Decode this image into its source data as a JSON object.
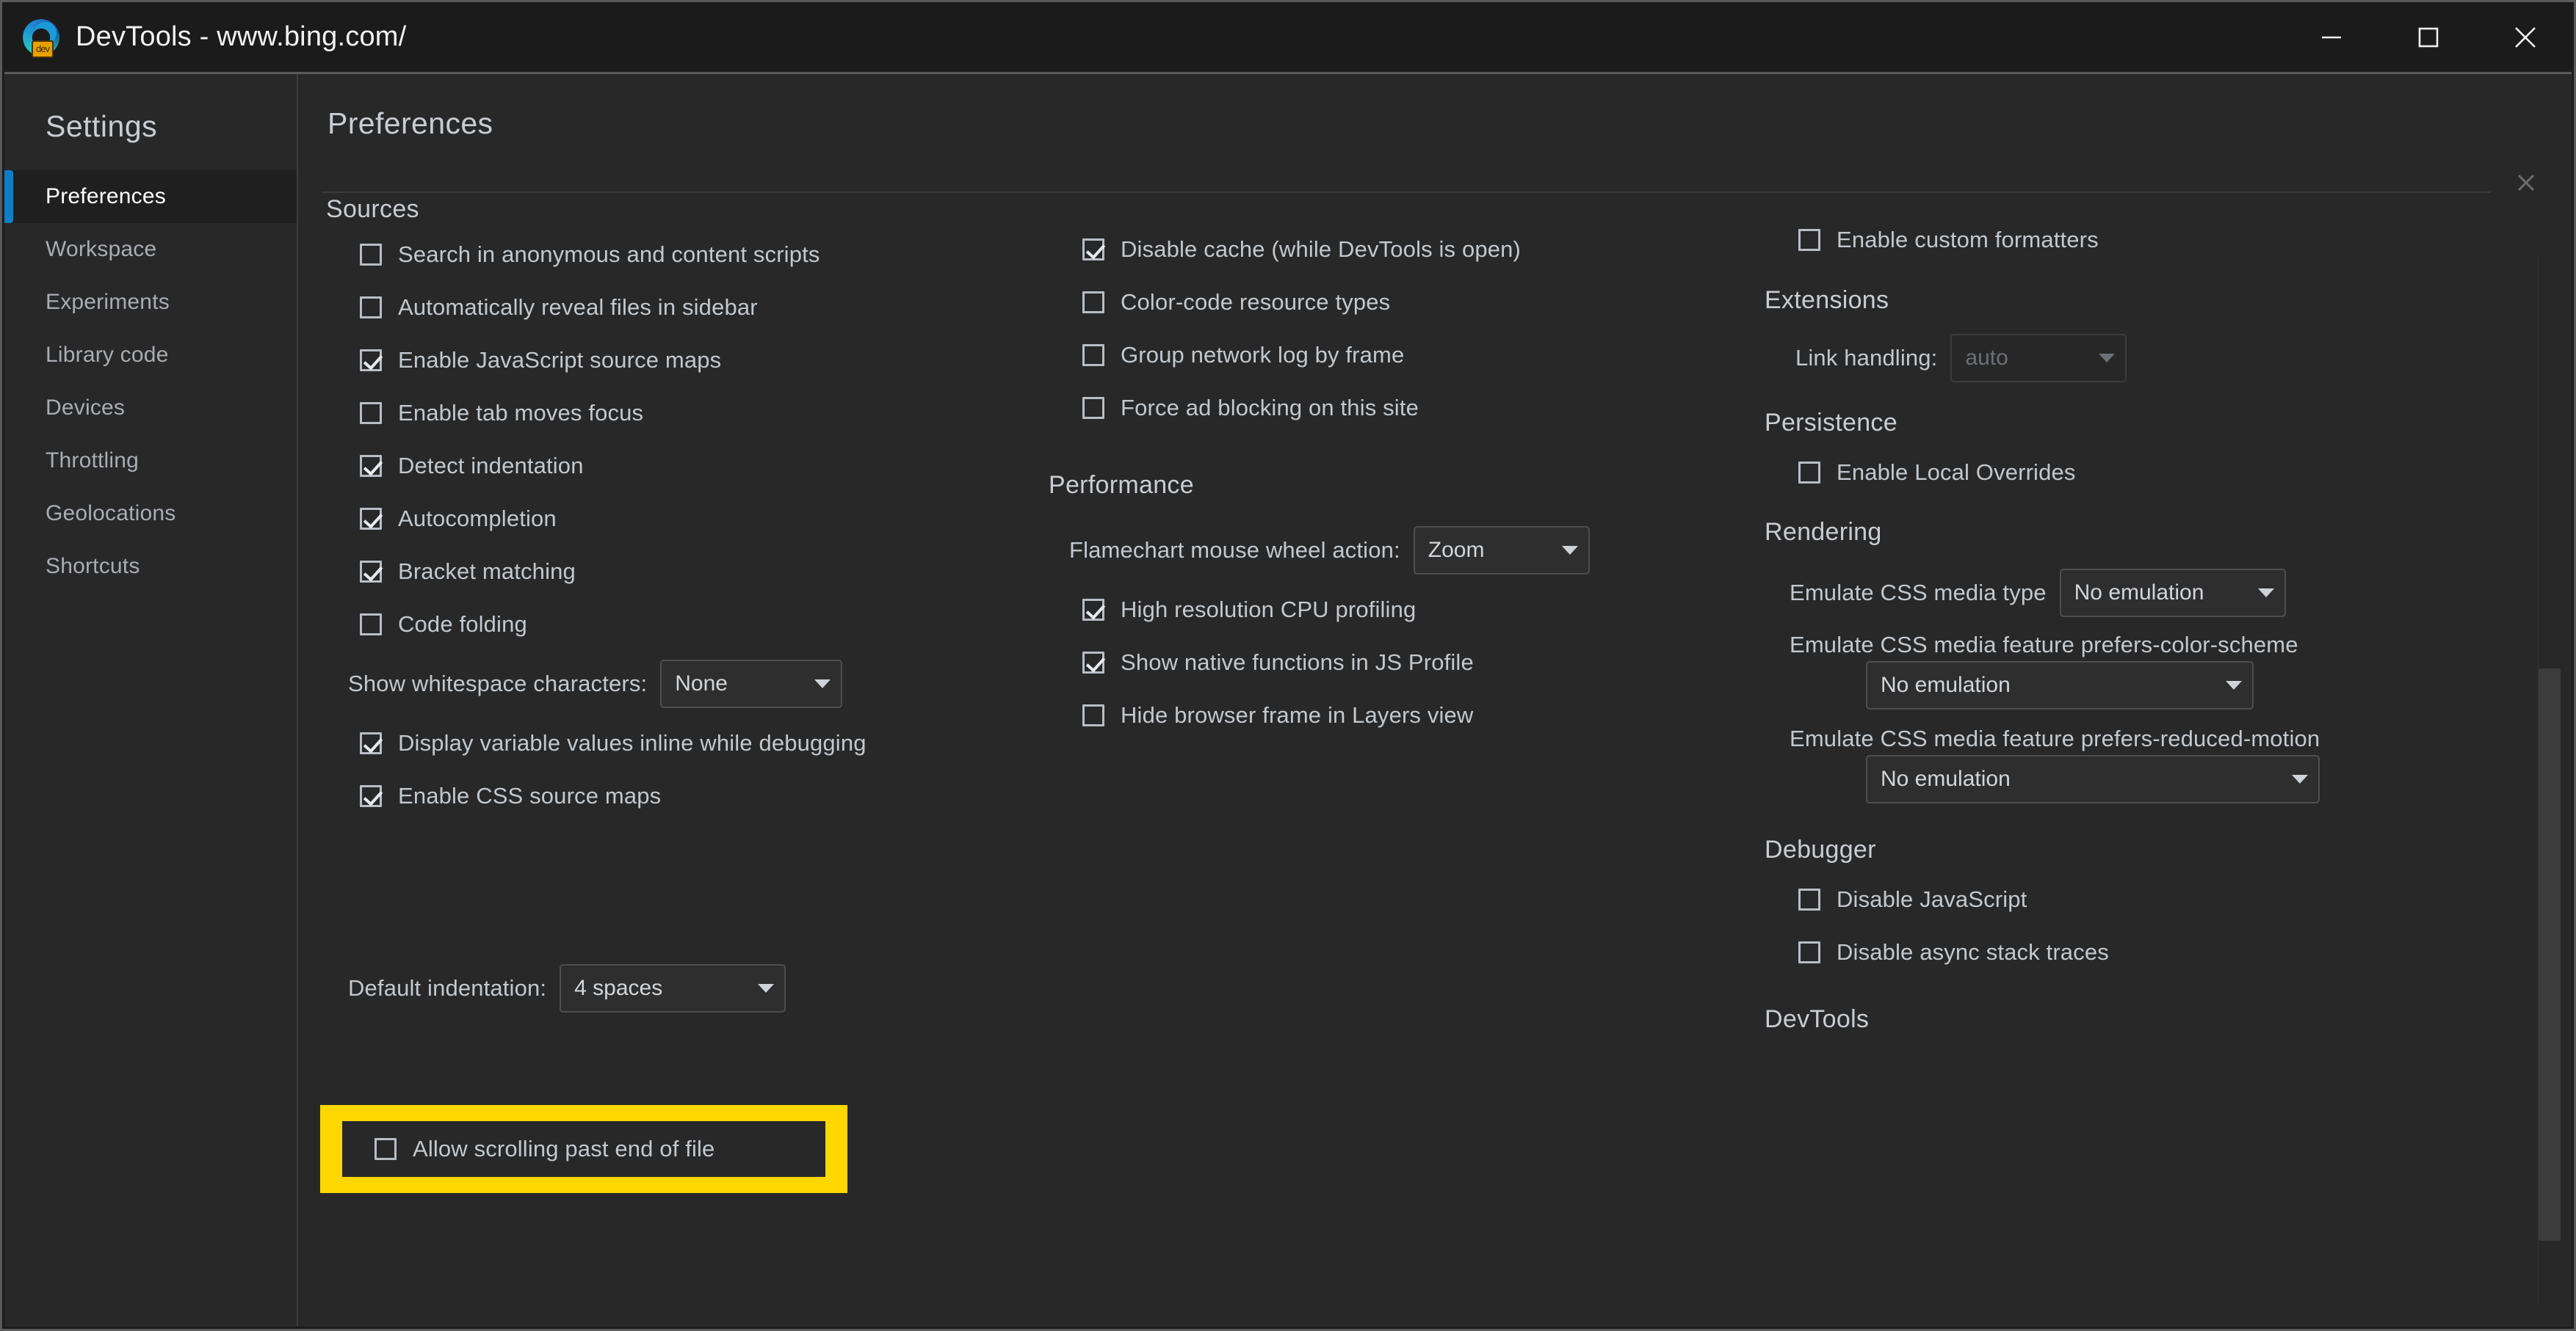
{
  "window": {
    "title": "DevTools - www.bing.com/",
    "app_icon": "edge-devtools-icon",
    "badge_text": "dev",
    "controls": {
      "minimize": "minimize-icon",
      "maximize": "maximize-icon",
      "close": "close-icon"
    }
  },
  "sidebar": {
    "title": "Settings",
    "items": [
      {
        "label": "Preferences",
        "selected": true
      },
      {
        "label": "Workspace",
        "selected": false
      },
      {
        "label": "Experiments",
        "selected": false
      },
      {
        "label": "Library code",
        "selected": false
      },
      {
        "label": "Devices",
        "selected": false
      },
      {
        "label": "Throttling",
        "selected": false
      },
      {
        "label": "Geolocations",
        "selected": false
      },
      {
        "label": "Shortcuts",
        "selected": false
      }
    ]
  },
  "panel": {
    "header": "Preferences",
    "close_label": "×"
  },
  "columns": {
    "left": {
      "section": "Sources",
      "checkboxes": [
        {
          "label": "Search in anonymous and content scripts",
          "checked": false
        },
        {
          "label": "Automatically reveal files in sidebar",
          "checked": false
        },
        {
          "label": "Enable JavaScript source maps",
          "checked": true
        },
        {
          "label": "Enable tab moves focus",
          "checked": false
        },
        {
          "label": "Detect indentation",
          "checked": true
        },
        {
          "label": "Autocompletion",
          "checked": true
        },
        {
          "label": "Bracket matching",
          "checked": true
        },
        {
          "label": "Code folding",
          "checked": false
        }
      ],
      "whitespace": {
        "label": "Show whitespace characters:",
        "value": "None"
      },
      "checkboxes2": [
        {
          "label": "Display variable values inline while debugging",
          "checked": true
        },
        {
          "label": "Enable CSS source maps",
          "checked": true
        }
      ],
      "highlighted": {
        "label": "Allow scrolling past end of file",
        "checked": false
      },
      "indentation": {
        "label": "Default indentation:",
        "value": "4 spaces"
      }
    },
    "middle": {
      "network_checkboxes": [
        {
          "label": "Disable cache (while DevTools is open)",
          "checked": true
        },
        {
          "label": "Color-code resource types",
          "checked": false
        },
        {
          "label": "Group network log by frame",
          "checked": false
        },
        {
          "label": "Force ad blocking on this site",
          "checked": false
        }
      ],
      "performance_section": "Performance",
      "flamechart": {
        "label": "Flamechart mouse wheel action:",
        "value": "Zoom"
      },
      "performance_checkboxes": [
        {
          "label": "High resolution CPU profiling",
          "checked": true
        },
        {
          "label": "Show native functions in JS Profile",
          "checked": true
        },
        {
          "label": "Hide browser frame in Layers view",
          "checked": false
        }
      ]
    },
    "right": {
      "top_checkbox": {
        "label": "Enable custom formatters",
        "checked": false
      },
      "extensions_section": "Extensions",
      "link_handling": {
        "label": "Link handling:",
        "value": "auto",
        "disabled": true
      },
      "persistence_section": "Persistence",
      "persistence_checkbox": {
        "label": "Enable Local Overrides",
        "checked": false
      },
      "rendering_section": "Rendering",
      "media_type": {
        "label": "Emulate CSS media type",
        "value": "No emulation"
      },
      "color_scheme": {
        "label": "Emulate CSS media feature prefers-color-scheme",
        "value": "No emulation"
      },
      "reduced_motion": {
        "label": "Emulate CSS media feature prefers-reduced-motion",
        "value": "No emulation"
      },
      "debugger_section": "Debugger",
      "debugger_checkboxes": [
        {
          "label": "Disable JavaScript",
          "checked": false
        },
        {
          "label": "Disable async stack traces",
          "checked": false
        }
      ],
      "devtools_section": "DevTools"
    }
  },
  "colors": {
    "highlight": "#ffd700",
    "accent": "#0f7dc6",
    "panel_bg": "#282828",
    "titlebar_bg": "#1b1b1b",
    "edge_mark": "#6e6410"
  }
}
